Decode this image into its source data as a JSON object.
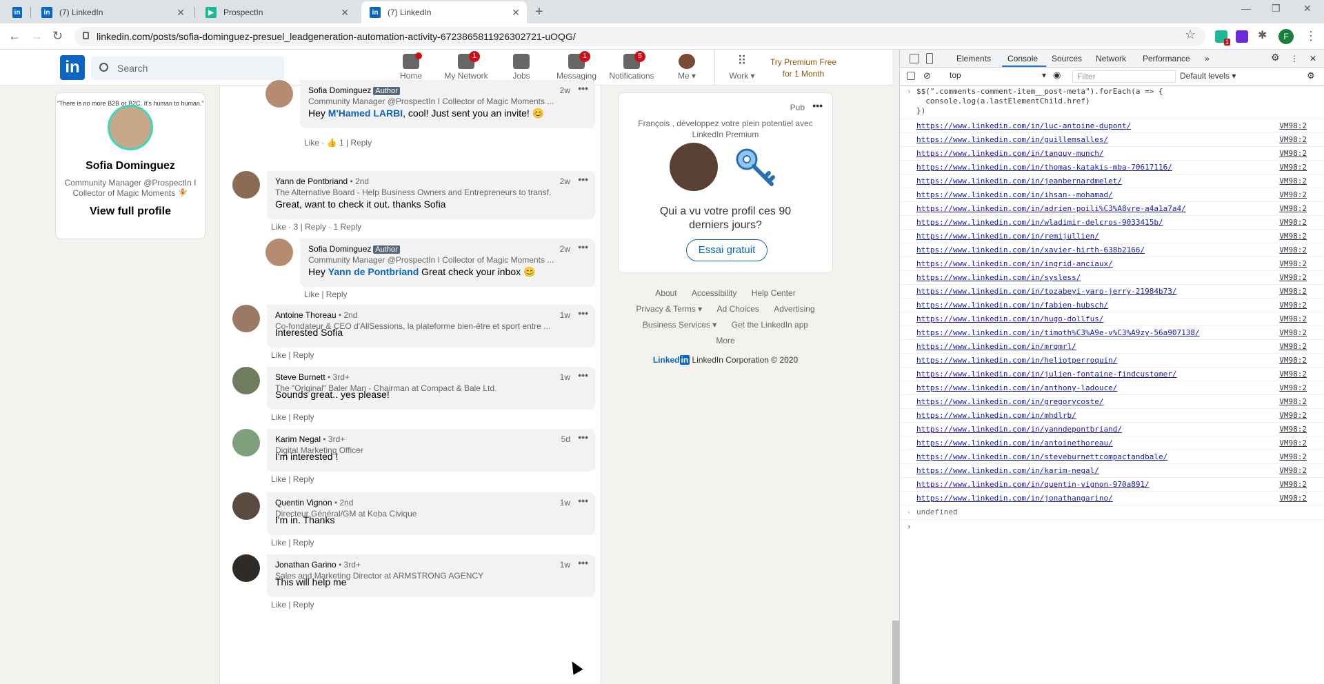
{
  "browser": {
    "tabs": [
      {
        "label": "",
        "kind": "linkedin"
      },
      {
        "label": "(7) LinkedIn",
        "kind": "linkedin"
      },
      {
        "label": "ProspectIn",
        "kind": "prospectin"
      },
      {
        "label": "(7) LinkedIn",
        "kind": "linkedin"
      }
    ],
    "url": "linkedin.com/posts/sofia-dominguez-presuel_leadgeneration-automation-activity-6723865811926302721-uOQG/",
    "ext_badge": "1",
    "profile_initial": "F",
    "colors": {
      "accent": "#0a66c2",
      "badge": "#cc1016"
    }
  },
  "linkedin": {
    "search_placeholder": "Search",
    "nav": [
      {
        "label": "Home",
        "badge": ""
      },
      {
        "label": "My Network",
        "badge": "1"
      },
      {
        "label": "Jobs",
        "badge": ""
      },
      {
        "label": "Messaging",
        "badge": "1"
      },
      {
        "label": "Notifications",
        "badge": "5"
      },
      {
        "label": "Me ▾",
        "badge": ""
      },
      {
        "label": "Work ▾",
        "badge": ""
      }
    ],
    "premium": {
      "line1": "Try Premium Free",
      "line2": "for 1 Month"
    },
    "profile": {
      "cover_text": "\"There is no more B2B or B2C. It's human to human.\"",
      "name": "Sofia Dominguez",
      "headline": "Community Manager @ProspectIn I Collector of Magic Moments 🧚",
      "view": "View full profile"
    },
    "comments": [
      {
        "name": "Sofia Dominguez",
        "degree": "",
        "author": "Author",
        "headline": "Community Manager @ProspectIn I Collector of Magic Moments ...",
        "time": "2w",
        "text_pre": "Hey ",
        "mention": "M'Hamed LARBI",
        "text_post": ", cool! Just sent you an invite! 😊",
        "actions": "Like · 👍 1 | Reply"
      },
      {
        "name": "Yann de Pontbriand",
        "degree": " • 2nd",
        "author": "",
        "headline": "The Alternative Board - Help Business Owners and Entrepreneurs to transf...",
        "time": "2w",
        "text_pre": "Great, want to check it out. thanks Sofia",
        "mention": "",
        "text_post": "",
        "actions": "Like · 3 | Reply · 1 Reply"
      },
      {
        "name": "Sofia Dominguez",
        "degree": "",
        "author": "Author",
        "headline": "Community Manager @ProspectIn I Collector of Magic Moments ...",
        "time": "2w",
        "text_pre": "Hey ",
        "mention": "Yann de Pontbriand",
        "text_post": " Great check your inbox 😊",
        "actions": "Like | Reply"
      },
      {
        "name": "Antoine Thoreau",
        "degree": " • 2nd",
        "author": "",
        "headline": "Co-fondateur & CEO d'AllSessions, la plateforme bien-être et sport entre ...",
        "time": "1w",
        "text_pre": "Interested Sofia",
        "mention": "",
        "text_post": "",
        "actions": "Like | Reply"
      },
      {
        "name": "Steve Burnett",
        "degree": " • 3rd+",
        "author": "",
        "headline": "The \"Original\" Baler Man - Chairman at Compact & Bale Ltd.",
        "time": "1w",
        "text_pre": "Sounds great.. yes please!",
        "mention": "",
        "text_post": "",
        "actions": "Like | Reply"
      },
      {
        "name": "Karim Negal",
        "degree": " • 3rd+",
        "author": "",
        "headline": "Digital Marketing Officer",
        "time": "5d",
        "text_pre": "I'm interested !",
        "mention": "",
        "text_post": "",
        "actions": "Like | Reply"
      },
      {
        "name": "Quentin Vignon",
        "degree": " • 2nd",
        "author": "",
        "headline": "Directeur Général/GM at Koba Civique",
        "time": "1w",
        "text_pre": "I'm in. Thanks",
        "mention": "",
        "text_post": "",
        "actions": "Like | Reply"
      },
      {
        "name": "Jonathan Garino",
        "degree": " • 3rd+",
        "author": "",
        "headline": "Sales and Marketing Director at ARMSTRONG AGENCY",
        "time": "1w",
        "text_pre": "This will help me",
        "mention": "",
        "text_post": "",
        "actions": "Like | Reply"
      }
    ],
    "ad": {
      "pub": "Pub",
      "line1": "François , développez votre plein potentiel avec LinkedIn Premium",
      "question": "Qui a vu votre profil ces 90 derniers jours?",
      "button": "Essai gratuit"
    },
    "footer": {
      "row1": [
        "About",
        "Accessibility",
        "Help Center"
      ],
      "row2": [
        "Privacy & Terms ▾",
        "Ad Choices",
        "Advertising"
      ],
      "row3": [
        "Business Services ▾",
        "Get the LinkedIn app"
      ],
      "row4": [
        "More"
      ],
      "brand": "Linked",
      "brand_in": "in",
      "corp": "LinkedIn Corporation © 2020"
    }
  },
  "devtools": {
    "tabs": [
      "Elements",
      "Console",
      "Sources",
      "Network",
      "Performance",
      "»"
    ],
    "context": "top",
    "filter_placeholder": "Filter",
    "levels": "Default levels ▾",
    "command": "$$(\".comments-comment-item__post-meta\").forEach(a => {\n  console.log(a.lastElementChild.href)\n})",
    "source": "VM98:2",
    "urls": [
      "https://www.linkedin.com/in/luc-antoine-dupont/",
      "https://www.linkedin.com/in/guillemsalles/",
      "https://www.linkedin.com/in/tanguy-munch/",
      "https://www.linkedin.com/in/thomas-katakis-mba-70617116/",
      "https://www.linkedin.com/in/jeanbernardmelet/",
      "https://www.linkedin.com/in/ihsan--mohamad/",
      "https://www.linkedin.com/in/adrien-poili%C3%A8vre-a4a1a7a4/",
      "https://www.linkedin.com/in/wladimir-delcros-9033415b/",
      "https://www.linkedin.com/in/remijullien/",
      "https://www.linkedin.com/in/xavier-hirth-638b2166/",
      "https://www.linkedin.com/in/ingrid-anciaux/",
      "https://www.linkedin.com/in/sysless/",
      "https://www.linkedin.com/in/tozabeyi-yaro-jerry-21984b73/",
      "https://www.linkedin.com/in/fabien-hubsch/",
      "https://www.linkedin.com/in/hugo-dollfus/",
      "https://www.linkedin.com/in/timoth%C3%A9e-v%C3%A9zy-56a907138/",
      "https://www.linkedin.com/in/mrqmrl/",
      "https://www.linkedin.com/in/heliotperroquin/",
      "https://www.linkedin.com/in/julien-fontaine-findcustomer/",
      "https://www.linkedin.com/in/anthony-ladouce/",
      "https://www.linkedin.com/in/gregorycoste/",
      "https://www.linkedin.com/in/mhdlrb/",
      "https://www.linkedin.com/in/yanndepontbriand/",
      "https://www.linkedin.com/in/antoinethoreau/",
      "https://www.linkedin.com/in/steveburnettcompactandbale/",
      "https://www.linkedin.com/in/karim-negal/",
      "https://www.linkedin.com/in/quentin-vignon-970a891/",
      "https://www.linkedin.com/in/jonathangarino/"
    ],
    "result": "undefined"
  }
}
